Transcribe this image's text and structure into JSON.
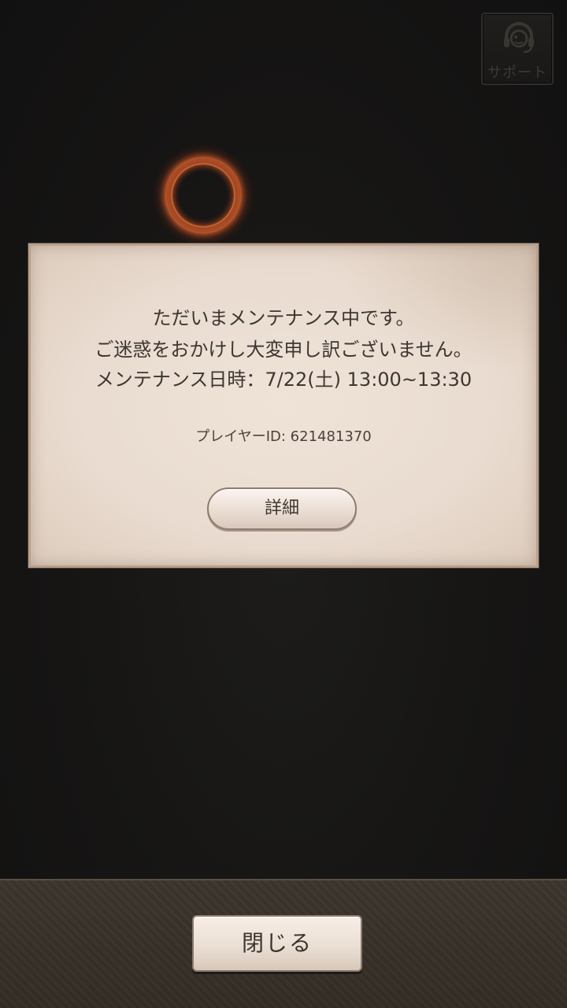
{
  "support": {
    "label": "サポート",
    "icon": "headset-icon"
  },
  "loading": {
    "icon": "loading-ring-icon",
    "color": "#c2552a"
  },
  "maintenance_dialog": {
    "message_lines": [
      "ただいまメンテナンス中です。",
      "ご迷惑をおかけし大変申し訳ございません。",
      "メンテナンス日時：7/22(土) 13:00~13:30"
    ],
    "player_id": "プレイヤーID: 621481370",
    "detail_button": "詳細"
  },
  "footer": {
    "close_button": "閉じる"
  }
}
